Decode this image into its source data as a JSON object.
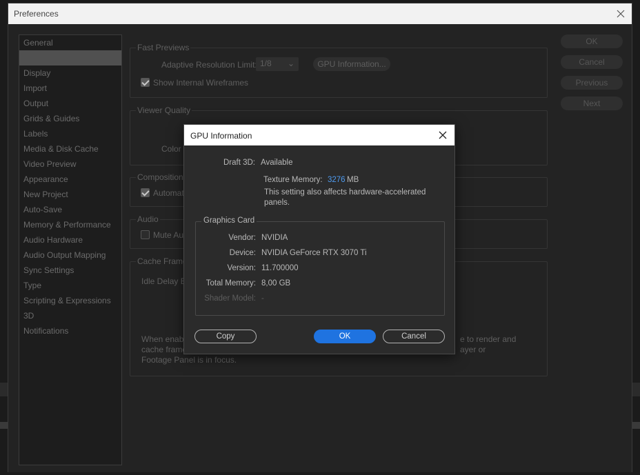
{
  "preferences": {
    "title": "Preferences",
    "nav_items": [
      {
        "label": "General"
      },
      {
        "label": ""
      },
      {
        "label": "Display"
      },
      {
        "label": "Import"
      },
      {
        "label": "Output"
      },
      {
        "label": "Grids & Guides"
      },
      {
        "label": "Labels"
      },
      {
        "label": "Media & Disk Cache"
      },
      {
        "label": "Video Preview"
      },
      {
        "label": "Appearance"
      },
      {
        "label": "New Project"
      },
      {
        "label": "Auto-Save"
      },
      {
        "label": "Memory & Performance"
      },
      {
        "label": "Audio Hardware"
      },
      {
        "label": "Audio Output Mapping"
      },
      {
        "label": "Sync Settings"
      },
      {
        "label": "Type"
      },
      {
        "label": "Scripting & Expressions"
      },
      {
        "label": "3D"
      },
      {
        "label": "Notifications"
      }
    ],
    "side_buttons": {
      "ok": "OK",
      "cancel": "Cancel",
      "previous": "Previous",
      "next": "Next"
    },
    "fast_previews": {
      "title": "Fast Previews",
      "adaptive_label": "Adaptive Resolution Limit:",
      "adaptive_value": "1/8",
      "gpu_info_button": "GPU Information...",
      "show_wireframes_label": "Show Internal Wireframes"
    },
    "viewer_quality": {
      "title": "Viewer Quality",
      "color_label": "Color M"
    },
    "composition": {
      "title": "Composition S",
      "checkbox_label": "Automati"
    },
    "audio": {
      "title": "Audio",
      "mute_label": "Mute Au"
    },
    "cache_frames": {
      "title": "Cache Frames",
      "idle_label": "Idle Delay Be",
      "note_left_1": "When enable",
      "note_left_2": "cache frame",
      "note_left_3": "Footage Panel is in focus.",
      "note_right_1": "e to render and",
      "note_right_2": "ayer or"
    }
  },
  "gpu_dialog": {
    "title": "GPU Information",
    "draft3d_label": "Draft 3D:",
    "draft3d_value": "Available",
    "texture_label": "Texture Memory:",
    "texture_value": "3276",
    "texture_unit": "MB",
    "note": "This setting also affects hardware-accelerated panels.",
    "graphics_card": {
      "title": "Graphics Card",
      "vendor_label": "Vendor:",
      "vendor_value": "NVIDIA",
      "device_label": "Device:",
      "device_value": "NVIDIA GeForce RTX 3070 Ti",
      "version_label": "Version:",
      "version_value": "11.700000",
      "total_memory_label": "Total Memory:",
      "total_memory_value": "8,00 GB",
      "shader_label": "Shader Model:",
      "shader_value": "-"
    },
    "buttons": {
      "copy": "Copy",
      "ok": "OK",
      "cancel": "Cancel"
    }
  },
  "colors": {
    "accent": "#1f73e0",
    "texture_value": "#4e9bf0"
  }
}
